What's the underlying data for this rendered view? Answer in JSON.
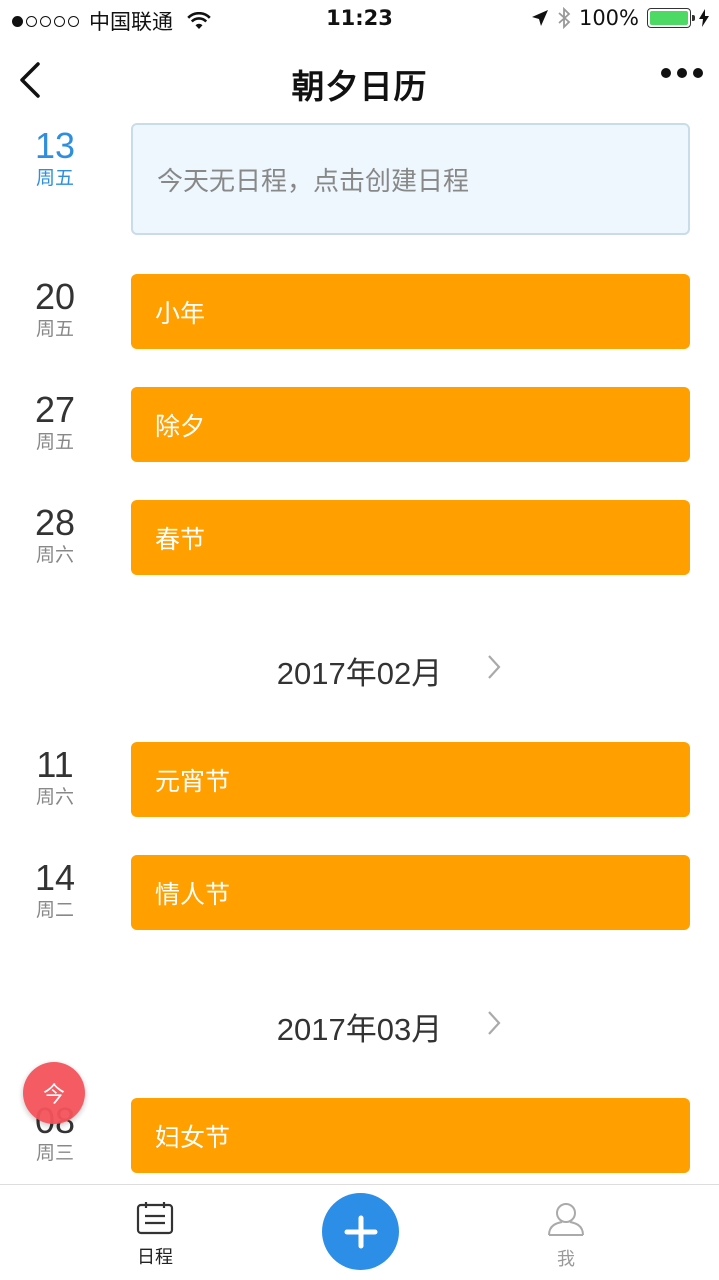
{
  "status_bar": {
    "carrier": "中国联通",
    "time": "11:23",
    "battery_text": "100%",
    "battery_level": 1.0,
    "signal_bars_filled": 1,
    "signal_bars_total": 5
  },
  "nav": {
    "title": "朝夕日历",
    "back_icon": "chevron-left-icon",
    "more_icon": "more-dots-icon"
  },
  "today_row": {
    "day": "13",
    "weekday": "周五",
    "empty_text": "今天无日程，点击创建日程"
  },
  "jan_events": [
    {
      "day": "20",
      "weekday": "周五",
      "title": "小年"
    },
    {
      "day": "27",
      "weekday": "周五",
      "title": "除夕"
    },
    {
      "day": "28",
      "weekday": "周六",
      "title": "春节"
    }
  ],
  "months": [
    {
      "label": "2017年02月",
      "events": [
        {
          "day": "11",
          "weekday": "周六",
          "title": "元宵节"
        },
        {
          "day": "14",
          "weekday": "周二",
          "title": "情人节"
        }
      ]
    },
    {
      "label": "2017年03月",
      "events": [
        {
          "day": "08",
          "weekday": "周三",
          "title": "妇女节"
        }
      ]
    }
  ],
  "today_fab": {
    "label": "今"
  },
  "tab_bar": {
    "schedule_label": "日程",
    "me_label": "我"
  },
  "colors": {
    "event_card": "#ff9f00",
    "today_accent": "#2f8fde",
    "fab_red": "#f5535a",
    "add_blue": "#2d8ee8"
  }
}
